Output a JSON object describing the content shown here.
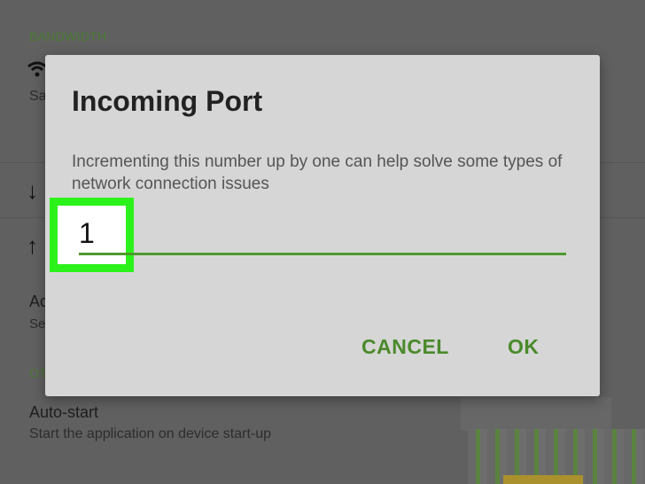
{
  "background": {
    "section_bandwidth": "BANDWIDTH",
    "bandwidth_row_sub": "Sa",
    "download_row_icon": "download-arrow-icon",
    "upload_row_icon": "upload-arrow-icon",
    "advanced_row_title": "Ac",
    "advanced_row_sub": "Se",
    "section_other": "OT",
    "autostart_title": "Auto-start",
    "autostart_sub": "Start the application on device start-up"
  },
  "dialog": {
    "title": "Incoming Port",
    "message": "Incrementing this number up by one can help solve some types of network connection issues",
    "port_value": "1",
    "cancel_label": "CANCEL",
    "ok_label": "OK"
  },
  "colors": {
    "accent": "#4a8a2b",
    "highlight": "#2bf21b",
    "dialog_bg": "#d6d6d6",
    "scrim": "#606060"
  }
}
